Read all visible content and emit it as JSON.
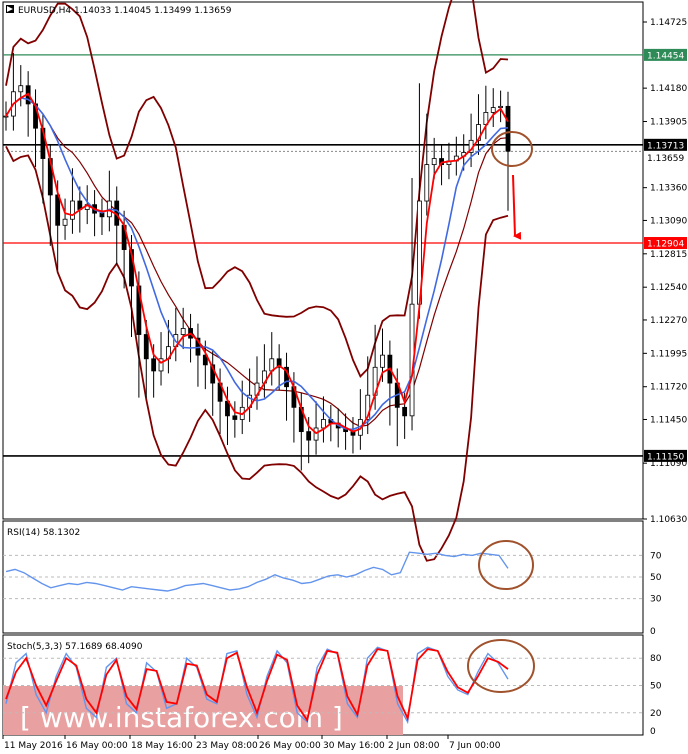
{
  "header": {
    "text": "EURUSD,H4  1.14033 1.14045 1.13499 1.13659"
  },
  "rsi": {
    "label": "RSI(14) 58.1302",
    "ticks": [
      "70",
      "50",
      "30",
      "0"
    ]
  },
  "stoch": {
    "label": "Stoch(5,3,3) 57.1689 68.4090",
    "ticks": [
      "80",
      "50",
      "20",
      "0"
    ]
  },
  "x_labels": [
    "11 May 2016",
    "16 May 00:00",
    "18 May 16:00",
    "23 May 08:00",
    "26 May 00:00",
    "30 May 16:00",
    "2 Jun 08:00",
    "7 Jun 00:00"
  ],
  "price_levels": [
    {
      "label": "1.14454",
      "value": 1.14454,
      "color": "#2e8b57",
      "badge_bg": "#2e8b57",
      "badge_fg": "#ffffff"
    },
    {
      "label": "1.13713",
      "value": 1.13713,
      "color": "#000000",
      "badge_bg": "#000000",
      "badge_fg": "#ffffff"
    },
    {
      "label": "1.12904",
      "value": 1.12904,
      "color": "#ff0000",
      "badge_bg": "#ff0000",
      "badge_fg": "#ffffff"
    },
    {
      "label": "1.11150",
      "value": 1.1115,
      "color": "#000000",
      "badge_bg": "#000000",
      "badge_fg": "#ffffff"
    }
  ],
  "current_price": {
    "label": "1.13659",
    "value": 1.13659
  },
  "watermark": "[ www.instaforex.com ]",
  "colors": {
    "candles": "#000000",
    "ma_fast": "#ff0000",
    "ma_slow": "#4169e1",
    "bollinger": "#800000",
    "rsi": "#6495ed",
    "stoch_main": "#6495ed",
    "stoch_signal": "#ff0000",
    "annotation": "#a0522d",
    "arrow": "#ff0000",
    "watermark_bg": "#e8a0a0"
  },
  "chart_data": {
    "type": "line",
    "symbol": "EURUSD",
    "timeframe": "H4",
    "ohlc": {
      "open": 1.14033,
      "high": 1.14045,
      "low": 1.13499,
      "close": 1.13659
    },
    "ylim": [
      1.1063,
      1.14725
    ],
    "y_ticks": [
      1.14725,
      1.1418,
      1.13905,
      1.1336,
      1.1309,
      1.12815,
      1.1254,
      1.1227,
      1.11995,
      1.1172,
      1.1145,
      1.1109,
      1.1063
    ],
    "y_tick_labels": [
      "1.14725",
      "1.14180",
      "1.13905",
      "1.13360",
      "1.13090",
      "1.12815",
      "1.12540",
      "1.12270",
      "1.11995",
      "1.11720",
      "1.11450",
      "1.11090",
      "1.10630"
    ],
    "x_tick_labels": [
      "11 May 2016",
      "16 May 00:00",
      "18 May 16:00",
      "23 May 08:00",
      "26 May 00:00",
      "30 May 16:00",
      "2 Jun 08:00",
      "7 Jun 00:00"
    ],
    "close_series": [
      1.1395,
      1.1415,
      1.142,
      1.1405,
      1.1385,
      1.136,
      1.133,
      1.1305,
      1.131,
      1.1325,
      1.1318,
      1.1322,
      1.1315,
      1.1312,
      1.1325,
      1.1305,
      1.1285,
      1.1255,
      1.1215,
      1.1195,
      1.1185,
      1.1195,
      1.1205,
      1.1215,
      1.122,
      1.1212,
      1.1198,
      1.119,
      1.1175,
      1.116,
      1.1148,
      1.1145,
      1.1155,
      1.1165,
      1.1175,
      1.1185,
      1.1195,
      1.1188,
      1.1172,
      1.1155,
      1.1135,
      1.1128,
      1.1138,
      1.1145,
      1.1142,
      1.1138,
      1.1135,
      1.1132,
      1.1145,
      1.1165,
      1.1188,
      1.1198,
      1.1175,
      1.1155,
      1.1148,
      1.124,
      1.1325,
      1.1355,
      1.136,
      1.1355,
      1.1358,
      1.1362,
      1.1365,
      1.1375,
      1.1388,
      1.1398,
      1.1402,
      1.1403,
      1.1366
    ],
    "series": [
      {
        "name": "RSI(14)",
        "last": 58.1302,
        "ylim": [
          0,
          100
        ],
        "levels": [
          70,
          50,
          30
        ],
        "values": [
          55,
          57,
          54,
          49,
          44,
          40,
          42,
          44,
          43,
          45,
          44,
          42,
          40,
          38,
          41,
          40,
          39,
          38,
          37,
          39,
          42,
          43,
          44,
          42,
          40,
          38,
          39,
          41,
          45,
          48,
          52,
          49,
          47,
          44,
          45,
          48,
          51,
          52,
          50,
          52,
          56,
          59,
          57,
          52,
          54,
          73,
          72,
          71,
          72,
          70,
          69,
          71,
          70,
          72,
          71,
          70,
          58
        ]
      },
      {
        "name": "Stoch(5,3,3) %K",
        "last": 57.1689,
        "ylim": [
          0,
          100
        ],
        "levels": [
          80,
          50,
          20
        ],
        "values": [
          30,
          75,
          85,
          40,
          20,
          60,
          85,
          70,
          25,
          15,
          70,
          80,
          30,
          20,
          75,
          65,
          25,
          30,
          80,
          70,
          35,
          30,
          85,
          88,
          40,
          15,
          60,
          88,
          75,
          20,
          10,
          70,
          90,
          85,
          30,
          15,
          80,
          92,
          88,
          30,
          10,
          85,
          92,
          88,
          60,
          45,
          40,
          65,
          85,
          75,
          57
        ]
      },
      {
        "name": "Stoch(5,3,3) %D",
        "last": 68.409,
        "ylim": [
          0,
          100
        ],
        "values": [
          35,
          65,
          80,
          50,
          28,
          55,
          80,
          72,
          35,
          20,
          62,
          78,
          38,
          24,
          68,
          66,
          32,
          30,
          74,
          72,
          40,
          32,
          80,
          86,
          48,
          20,
          55,
          84,
          78,
          28,
          12,
          62,
          88,
          86,
          38,
          18,
          72,
          90,
          88,
          38,
          14,
          78,
          90,
          88,
          65,
          48,
          42,
          60,
          80,
          76,
          68
        ]
      }
    ]
  }
}
